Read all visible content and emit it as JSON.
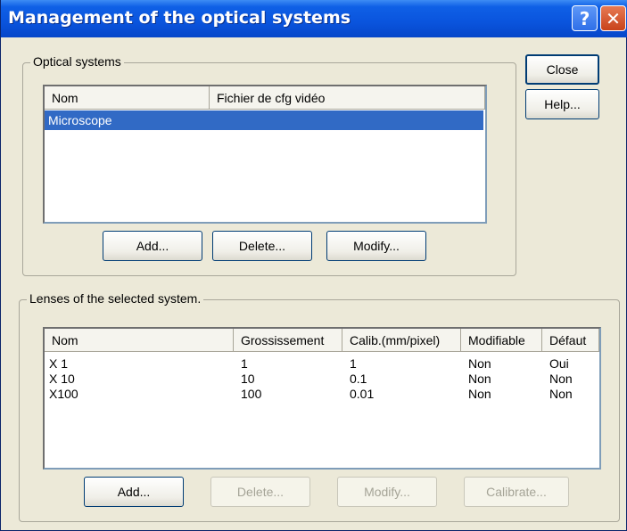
{
  "window": {
    "title": "Management of the optical systems",
    "help_glyph": "?",
    "close_glyph": "✕"
  },
  "side_buttons": {
    "close_label": "Close",
    "help_label": "Help..."
  },
  "optical_systems": {
    "group_label": "Optical systems",
    "columns": [
      "Nom",
      "Fichier de cfg vidéo"
    ],
    "rows": [
      {
        "nom": "Microscope",
        "fichier": "",
        "selected": true
      }
    ],
    "buttons": {
      "add": "Add...",
      "delete": "Delete...",
      "modify": "Modify..."
    }
  },
  "lenses": {
    "group_label": "Lenses of the selected system.",
    "columns": [
      "Nom",
      "Grossissement",
      "Calib.(mm/pixel)",
      "Modifiable",
      "Défaut"
    ],
    "rows": [
      {
        "nom": "X 1",
        "grossissement": "1",
        "calib": "1",
        "modifiable": "Non",
        "defaut": "Oui"
      },
      {
        "nom": "X 10",
        "grossissement": "10",
        "calib": "0.1",
        "modifiable": "Non",
        "defaut": "Non"
      },
      {
        "nom": "X100",
        "grossissement": "100",
        "calib": "0.01",
        "modifiable": "Non",
        "defaut": "Non"
      }
    ],
    "buttons": {
      "add": "Add...",
      "delete": "Delete...",
      "modify": "Modify...",
      "calibrate": "Calibrate..."
    }
  },
  "colors": {
    "titlebar": "#0a54dd",
    "selection": "#316ac5",
    "dialog_bg": "#ece9d8"
  }
}
